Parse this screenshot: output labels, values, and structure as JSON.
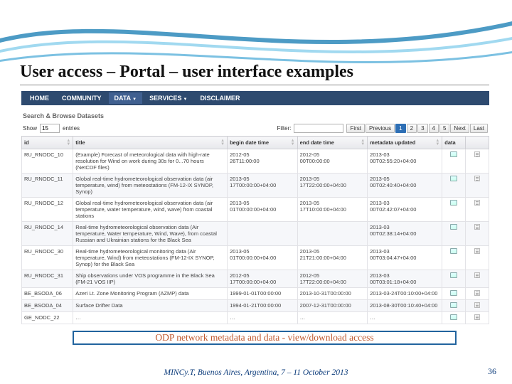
{
  "slide": {
    "title": "User access – Portal – user interface examples",
    "callout": "ODP network metadata and data  -  view/download access",
    "footer": "MINCy.T, Buenos Aires, Argentina, 7 – 11 October 2013",
    "page_number": "36"
  },
  "nav": {
    "items": [
      "HOME",
      "COMMUNITY",
      "DATA",
      "SERVICES",
      "DISCLAIMER"
    ],
    "active_index": 2,
    "dropdown_indices": [
      2,
      3
    ]
  },
  "table_section": {
    "heading": "Search & Browse Datasets",
    "show_label": "Show",
    "entries_value": "15",
    "entries_label": "entries",
    "filter_label": "Filter:",
    "filter_value": ""
  },
  "pagination": {
    "first": "First",
    "previous": "Previous",
    "pages": [
      "1",
      "2",
      "3",
      "4",
      "5"
    ],
    "active": 0,
    "next": "Next",
    "last": "Last"
  },
  "columns": [
    "id",
    "title",
    "begin date time",
    "end date time",
    "metadata updated",
    "data",
    ""
  ],
  "rows": [
    {
      "id": "RU_RNODC_10",
      "title": "(Example) Forecast of meteorological data with high-rate resolution for Wind on work during 30s for 0...70 hours (NetCDF files)",
      "begin": "2012-05\n26T11:00:00",
      "end": "2012-05\n00T00:00:00",
      "meta": "2013-03\n00T02:55:20+04:00"
    },
    {
      "id": "RU_RNODC_11",
      "title": "Global real-time hydrometeorological observation data (air temperature, wind) from meteostations (FM-12-IX SYNOP, Synop)",
      "begin": "2013-05\n17T00:00:00+04:00",
      "end": "2013-05\n17T22:00:00+04:00",
      "meta": "2013-05\n00T02:40:40+04:00"
    },
    {
      "id": "RU_RNODC_12",
      "title": "Global real-time hydrometeorological observation data (air temperature, water temperature, wind, wave) from coastal stations",
      "begin": "2013-05\n01T00:00:00+04:00",
      "end": "2013-05\n17T10:00:00+04:00",
      "meta": "2013-03\n00T02:42:07+04:00"
    },
    {
      "id": "RU_RNODC_14",
      "title": "Real-time hydrometeorological observation data (Air temperature, Water temperature, Wind, Wave), from coastal Russian and Ukrainian stations for the Black Sea",
      "begin": "",
      "end": "",
      "meta": "2013-03\n00T02:38:14+04:00"
    },
    {
      "id": "RU_RNODC_30",
      "title": "Real-time hydrometeorological monitoring data (Air temperature, Wind) from meteostations (FM-12-IX SYNOP, Synop) for the Black Sea",
      "begin": "2013-05\n01T00:00:00+04:00",
      "end": "2013-05\n21T21:00:00+04:00",
      "meta": "2013-03\n00T03:04:47+04:00"
    },
    {
      "id": "RU_RNODC_31",
      "title": "Ship observations under VOS programme in the Black Sea (FM-21 VOS IIP)",
      "begin": "2012-05\n17T00:00:00+04:00",
      "end": "2012-05\n17T22:00:00+04:00",
      "meta": "2013-03\n00T03:01:18+04:00"
    },
    {
      "id": "BE_BSODA_06",
      "title": "Azeri Lt. Zone Monitoring Program (AZMP) data",
      "begin": "1999-01-01T00:00:00",
      "end": "2013-10-31T00:00:00",
      "meta": "2013-03-24T00:10:00+04:00"
    },
    {
      "id": "BE_BSODA_04",
      "title": "Surface Drifter Data",
      "begin": "1994-01-21T00:00:00",
      "end": "2007-12-31T00:00:00",
      "meta": "2013-08-30T00:10:40+04:00"
    },
    {
      "id": "GE_NODC_22",
      "title": "…",
      "begin": "…",
      "end": "…",
      "meta": "…"
    }
  ]
}
